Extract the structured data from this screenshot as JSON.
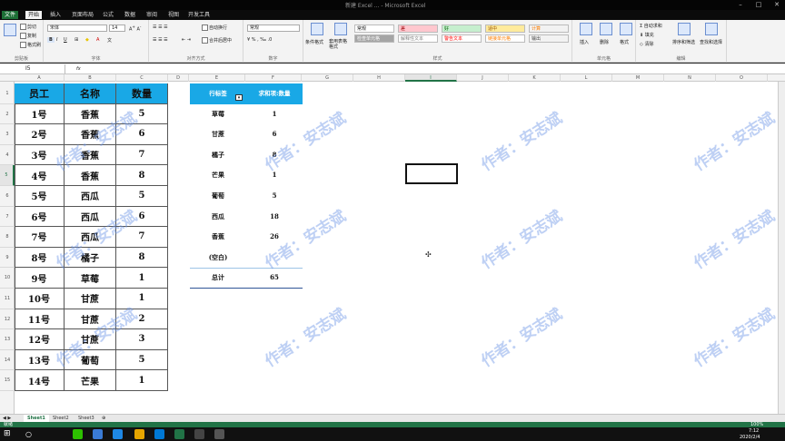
{
  "window": {
    "title": "新建 Excel ... - Microsoft Excel"
  },
  "menu": {
    "file": "文件",
    "items": [
      "开始",
      "插入",
      "页面布局",
      "公式",
      "数据",
      "审阅",
      "视图",
      "开发工具"
    ]
  },
  "ribbon": {
    "clipboard": {
      "cut": "剪切",
      "copy": "复制",
      "format_painter": "格式刷",
      "label": "剪贴板"
    },
    "font": {
      "name": "宋体",
      "size": "14",
      "label": "字体"
    },
    "alignment": {
      "wrap": "自动换行",
      "merge": "合并后居中",
      "label": "对齐方式"
    },
    "number": {
      "format": "常规",
      "label": "数字"
    },
    "styles": {
      "conditional": "条件格式",
      "table": "套用表格格式",
      "cells": [
        {
          "text": "常规",
          "bg": "#ffffff",
          "color": "#111111"
        },
        {
          "text": "差",
          "bg": "#ffc7ce",
          "color": "#9c0006"
        },
        {
          "text": "好",
          "bg": "#c6efce",
          "color": "#006100"
        },
        {
          "text": "适中",
          "bg": "#ffeb9c",
          "color": "#9c5700"
        },
        {
          "text": "计算",
          "bg": "#f2f2f2",
          "color": "#fa7d00"
        },
        {
          "text": "检查单元格",
          "bg": "#a5a5a5",
          "color": "#ffffff"
        },
        {
          "text": "解释性文本",
          "bg": "#ffffff",
          "color": "#7f7f7f"
        },
        {
          "text": "警告文本",
          "bg": "#ffffff",
          "color": "#ff0000"
        },
        {
          "text": "链接单元格",
          "bg": "#ffffff",
          "color": "#fa7d00"
        },
        {
          "text": "输出",
          "bg": "#f2f2f2",
          "color": "#3f3f3f"
        }
      ],
      "label": "样式"
    },
    "cells": {
      "insert": "插入",
      "delete": "删除",
      "format": "格式",
      "label": "单元格"
    },
    "editing": {
      "autosum": "自动求和",
      "fill": "填充",
      "clear": "清除",
      "sort": "排序和筛选",
      "find": "查找和选择",
      "label": "编辑"
    }
  },
  "formula_bar": {
    "name_box": "I5",
    "fx": "fx",
    "value": ""
  },
  "columns": [
    "A",
    "B",
    "C",
    "D",
    "E",
    "F",
    "G",
    "H",
    "I",
    "J",
    "K",
    "L",
    "M",
    "N",
    "O"
  ],
  "selected_column": "I",
  "rows": [
    "1",
    "2",
    "3",
    "4",
    "5",
    "6",
    "7",
    "8",
    "9",
    "10",
    "11",
    "12",
    "13",
    "14",
    "15"
  ],
  "selected_row": "5",
  "table": {
    "headers": [
      "员工",
      "名称",
      "数量"
    ],
    "rows": [
      [
        "1号",
        "香蕉",
        "5"
      ],
      [
        "2号",
        "香蕉",
        "6"
      ],
      [
        "3号",
        "香蕉",
        "7"
      ],
      [
        "4号",
        "香蕉",
        "8"
      ],
      [
        "5号",
        "西瓜",
        "5"
      ],
      [
        "6号",
        "西瓜",
        "6"
      ],
      [
        "7号",
        "西瓜",
        "7"
      ],
      [
        "8号",
        "橘子",
        "8"
      ],
      [
        "9号",
        "草莓",
        "1"
      ],
      [
        "10号",
        "甘蔗",
        "1"
      ],
      [
        "11号",
        "甘蔗",
        "2"
      ],
      [
        "12号",
        "甘蔗",
        "3"
      ],
      [
        "13号",
        "葡萄",
        "5"
      ],
      [
        "14号",
        "芒果",
        "1"
      ]
    ]
  },
  "pivot": {
    "headers": [
      "行标签",
      "求和项:数量"
    ],
    "rows": [
      [
        "草莓",
        "1"
      ],
      [
        "甘蔗",
        "6"
      ],
      [
        "橘子",
        "8"
      ],
      [
        "芒果",
        "1"
      ],
      [
        "葡萄",
        "5"
      ],
      [
        "西瓜",
        "18"
      ],
      [
        "香蕉",
        "26"
      ],
      [
        "(空白)",
        ""
      ]
    ],
    "total": [
      "总计",
      "65"
    ]
  },
  "watermark": "作者：安志斌",
  "sheets": [
    "Sheet1",
    "Sheet2",
    "Sheet3"
  ],
  "active_sheet": "Sheet1",
  "status": {
    "text": "就绪",
    "zoom": "100%"
  },
  "taskbar": {
    "time": "7:12",
    "date": "2020/2/4"
  }
}
